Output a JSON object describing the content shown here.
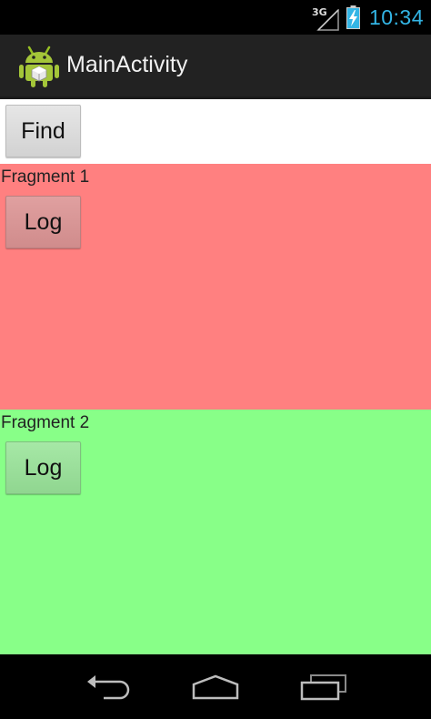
{
  "status_bar": {
    "network_type": "3G",
    "time": "10:34",
    "icons": [
      "signal-icon",
      "battery-charging-icon"
    ]
  },
  "action_bar": {
    "app_icon": "android-icon",
    "title": "MainActivity"
  },
  "main": {
    "find_label": "Find",
    "fragments": [
      {
        "label": "Fragment 1",
        "button_label": "Log",
        "color": "#ff8080"
      },
      {
        "label": "Fragment 2",
        "button_label": "Log",
        "color": "#88ff88"
      }
    ]
  },
  "nav_bar": {
    "icons": [
      "back-icon",
      "home-icon",
      "recent-apps-icon"
    ]
  },
  "colors": {
    "clock_accent": "#33b5e5",
    "action_bar": "#222222"
  }
}
